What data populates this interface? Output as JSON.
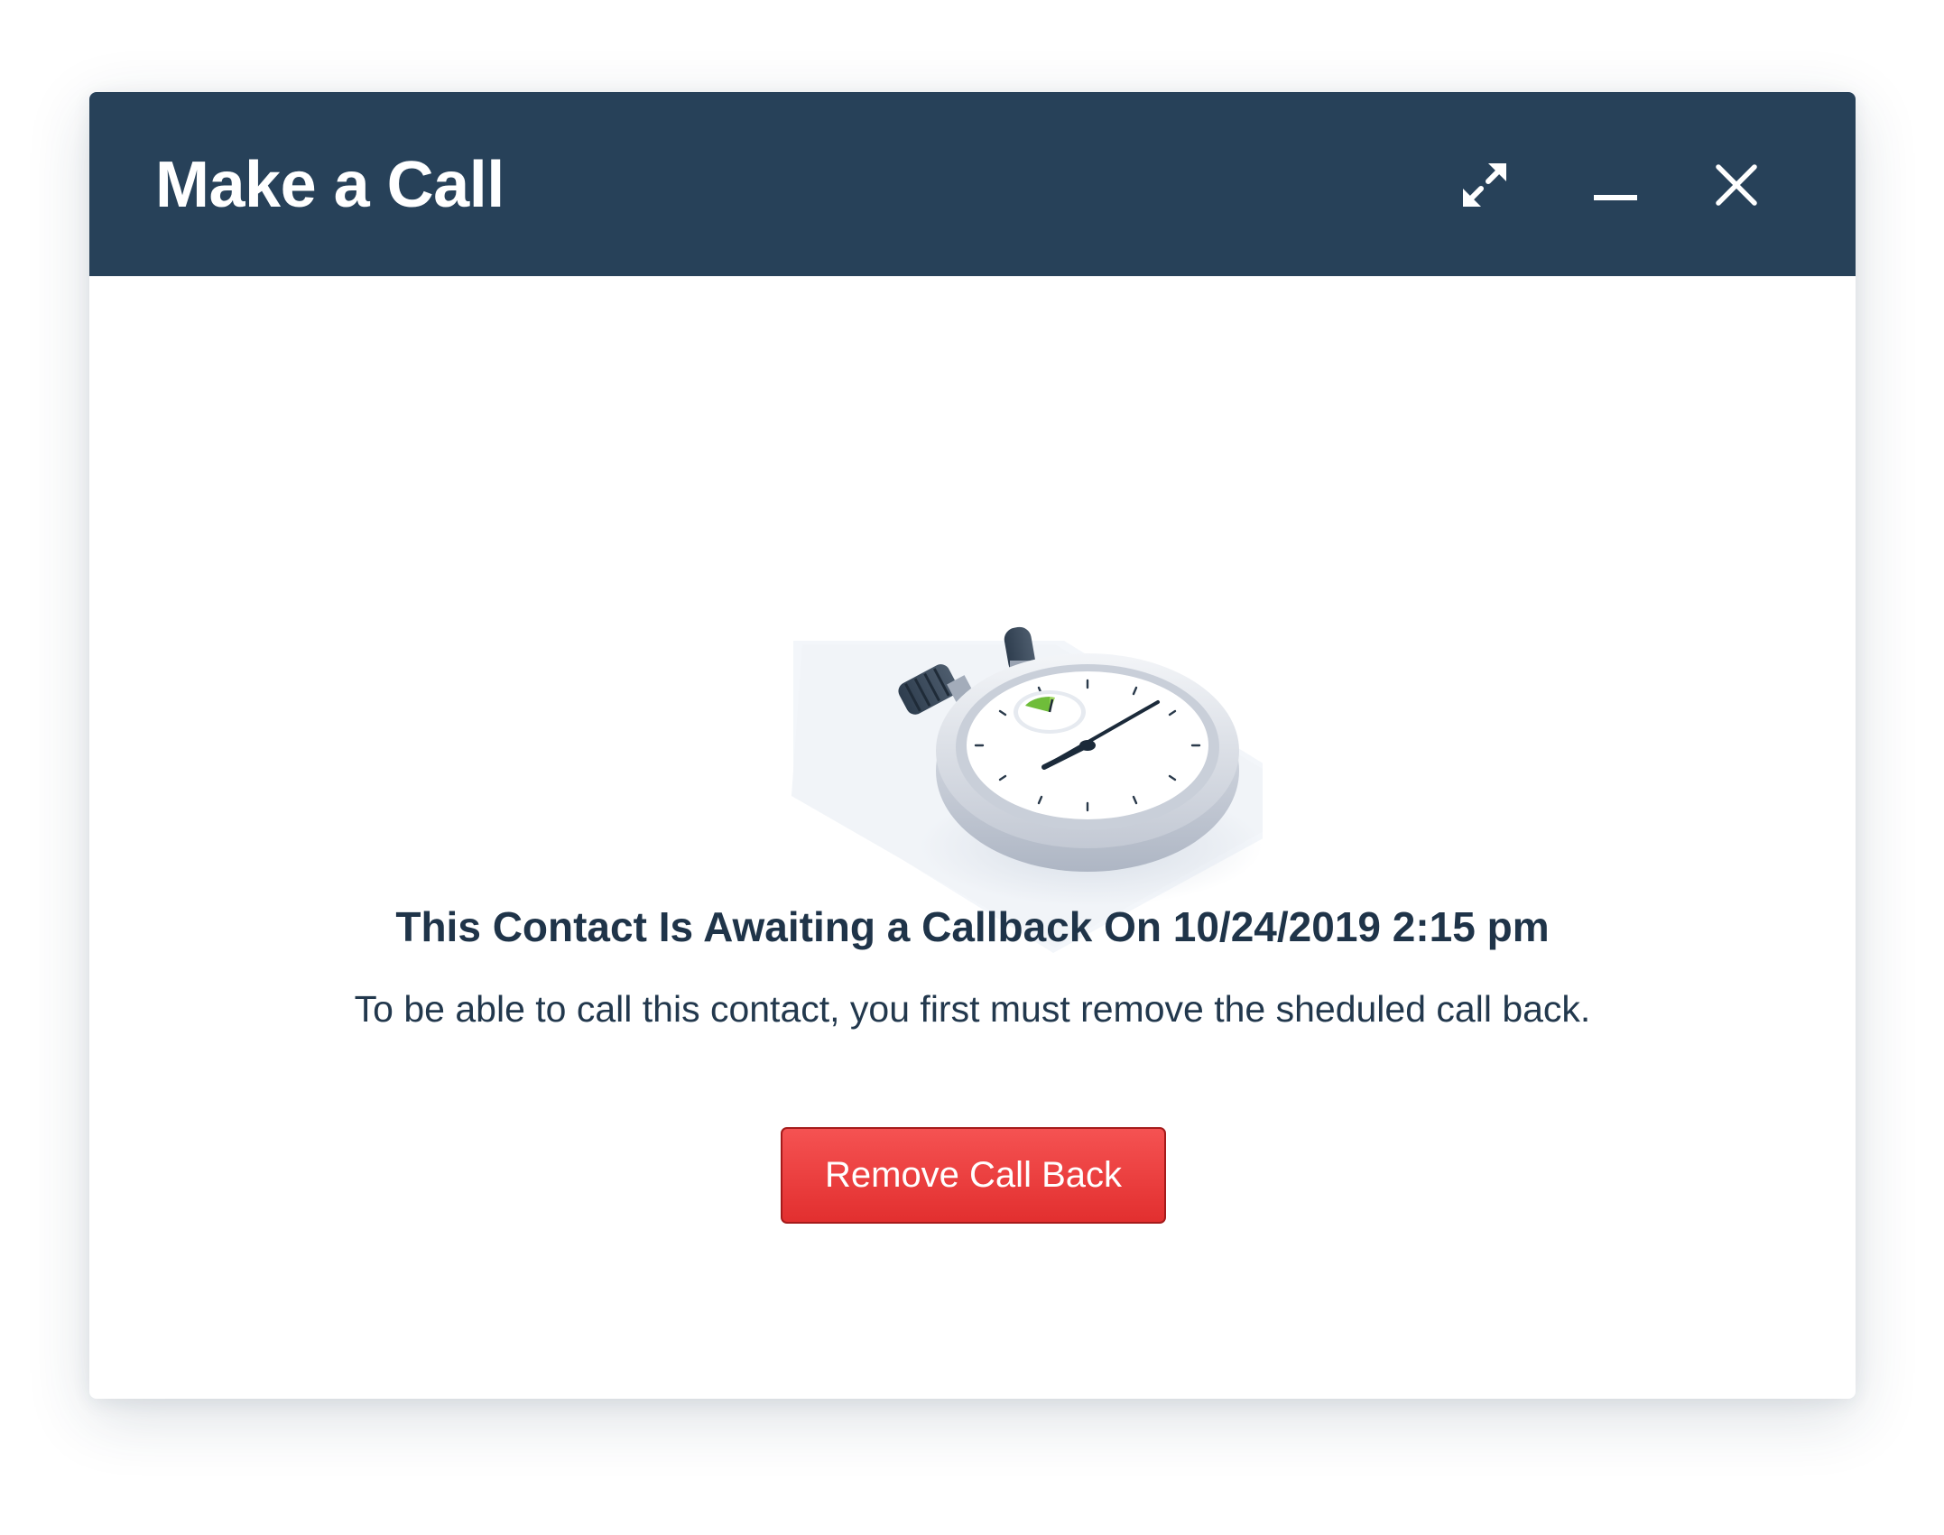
{
  "dialog": {
    "title": "Make a Call",
    "controls": {
      "expand_icon": "expand-arrows-icon",
      "minimize_icon": "minimize-icon",
      "close_icon": "close-icon"
    }
  },
  "content": {
    "illustration_icon": "stopwatch-icon",
    "heading": "This Contact Is Awaiting a Callback On 10/24/2019 2:15 pm",
    "description": "To be able to call this contact, you first must remove the sheduled call back.",
    "button_label": "Remove Call Back"
  },
  "colors": {
    "titlebar": "#274159",
    "button": "#e53838",
    "text": "#1f3449"
  }
}
